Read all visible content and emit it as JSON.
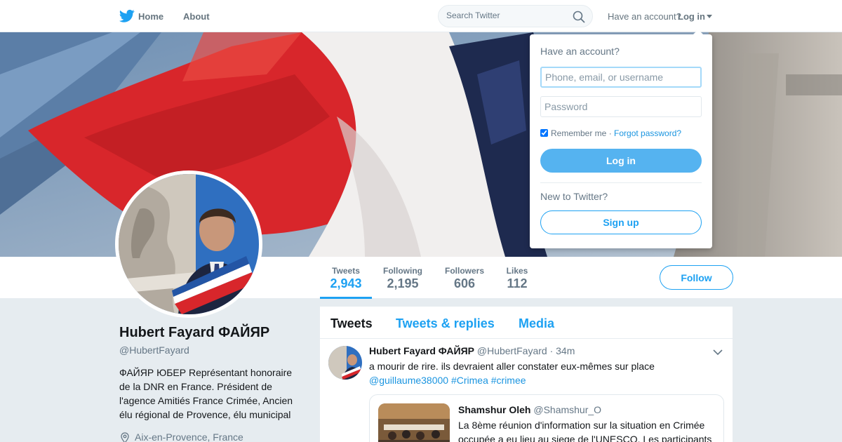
{
  "nav": {
    "logo_icon": "twitter-bird-icon",
    "home_label": "Home",
    "about_label": "About",
    "search_placeholder": "Search Twitter",
    "have_account_label": "Have an account?",
    "login_label": "Log in"
  },
  "profile_nav": {
    "stats": [
      {
        "label": "Tweets",
        "value": "2,943"
      },
      {
        "label": "Following",
        "value": "2,195"
      },
      {
        "label": "Followers",
        "value": "606"
      },
      {
        "label": "Likes",
        "value": "112"
      }
    ],
    "follow_label": "Follow"
  },
  "profile": {
    "name": "Hubert Fayard ФАЙЯР",
    "handle": "@HubertFayard",
    "bio": "ФАЙЯР ЮБЕР Représentant honoraire de la DNR en France. Président de l'agence Amitiés France Crimée, Ancien élu régional de Provence, élu municipal",
    "location": "Aix-en-Provence, France"
  },
  "timeline": {
    "tabs": [
      "Tweets",
      "Tweets & replies",
      "Media"
    ],
    "tweet": {
      "name": "Hubert Fayard ФАЙЯР",
      "meta": "@HubertFayard · 34m",
      "text": "a mourir de rire. ils devraient aller constater eux-mêmes sur place",
      "links": "@guillaume38000 #Crimea #crimee",
      "quote": {
        "name": "Shamshur Oleh",
        "handle": "@Shamshur_O",
        "text": "La 8ème réunion d'information sur la situation en Crimée occupée a eu lieu au siege de l'UNESCO. Les participants"
      }
    }
  },
  "login_dropdown": {
    "title": "Have an account?",
    "username_placeholder": "Phone, email, or username",
    "password_placeholder": "Password",
    "remember_label": "Remember me ·",
    "forgot_label": "Forgot password?",
    "login_button": "Log in",
    "new_label": "New to Twitter?",
    "signup_button": "Sign up"
  },
  "colors": {
    "accent": "#1da1f2",
    "login_button": "#55b3f0",
    "link": "#1b95e0"
  }
}
